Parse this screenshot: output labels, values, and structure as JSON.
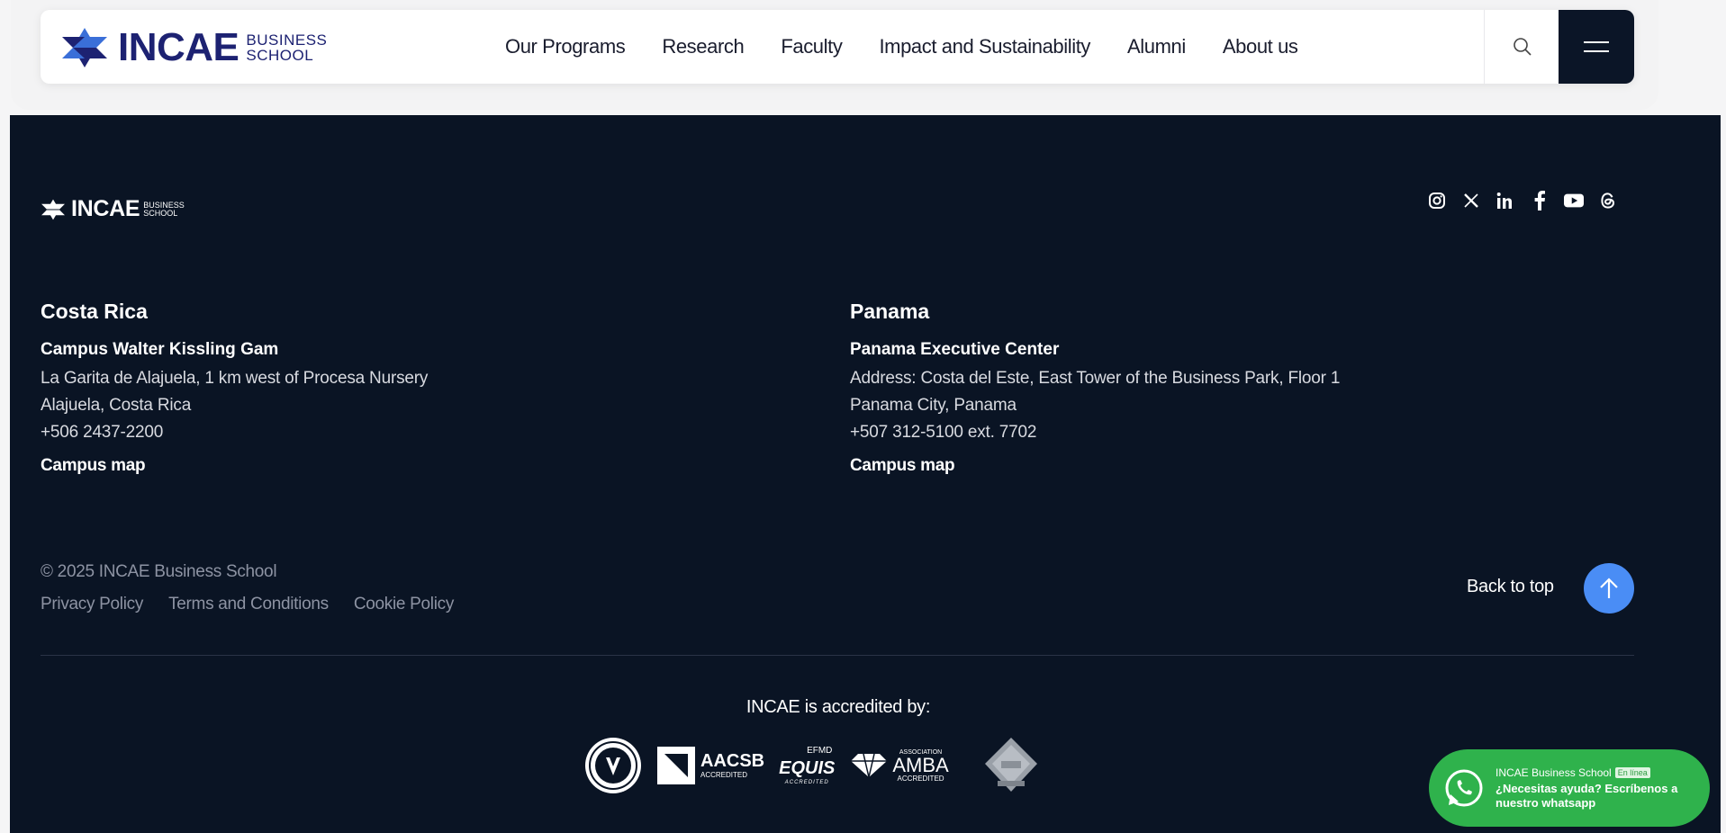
{
  "header": {
    "logo": {
      "word": "INCAE",
      "sub_line1": "BUSINESS",
      "sub_line2": "SCHOOL"
    },
    "nav": [
      {
        "label": "Our Programs"
      },
      {
        "label": "Research"
      },
      {
        "label": "Faculty"
      },
      {
        "label": "Impact and Sustainability"
      },
      {
        "label": "Alumni"
      },
      {
        "label": "About us"
      }
    ],
    "search_icon": "search-icon",
    "menu_icon": "hamburger-menu-icon"
  },
  "footer": {
    "logo": {
      "word": "INCAE",
      "sub_line1": "BUSINESS",
      "sub_line2": "SCHOOL"
    },
    "socials": [
      "instagram-icon",
      "x-icon",
      "linkedin-icon",
      "facebook-icon",
      "youtube-icon",
      "threads-icon"
    ],
    "costa_rica": {
      "heading": "Costa Rica",
      "campus_name": "Campus Walter Kissling Gam",
      "lines": [
        "La Garita de Alajuela, 1 km west of Procesa Nursery",
        "Alajuela, Costa Rica",
        "+506 2437-2200"
      ],
      "map_link": "Campus map"
    },
    "panama": {
      "heading": "Panama",
      "campus_name": "Panama Executive Center",
      "lines": [
        "Address: Costa del Este, East Tower of the Business Park, Floor 1",
        "Panama City, Panama",
        "+507 312-5100 ext. 7702"
      ],
      "map_link": "Campus map"
    },
    "copyright": "© 2025 INCAE Business School",
    "legal": [
      {
        "label": "Privacy Policy"
      },
      {
        "label": "Terms and Conditions"
      },
      {
        "label": "Cookie Policy"
      }
    ],
    "back_to_top": "Back to top",
    "accredited_title": "INCAE is accredited by:",
    "badges": {
      "aacsb_name": "AACSB",
      "aacsb_sub": "ACCREDITED",
      "efmd": "EFMD",
      "equis": "EQUIS",
      "equis_sub": "ACCREDITED",
      "amba_assoc": "ASSOCIATION",
      "amba_name": "AMBA",
      "amba_sub": "ACCREDITED"
    }
  },
  "whatsapp": {
    "name": "INCAE Business School",
    "status": "En línea",
    "message": "¿Necesitas ayuda? Escríbenos a nuestro whatsapp"
  },
  "colors": {
    "navy": "#0a1424",
    "brand": "#1d2272",
    "accent": "#4a8df5",
    "whatsapp": "#2fb24c"
  }
}
